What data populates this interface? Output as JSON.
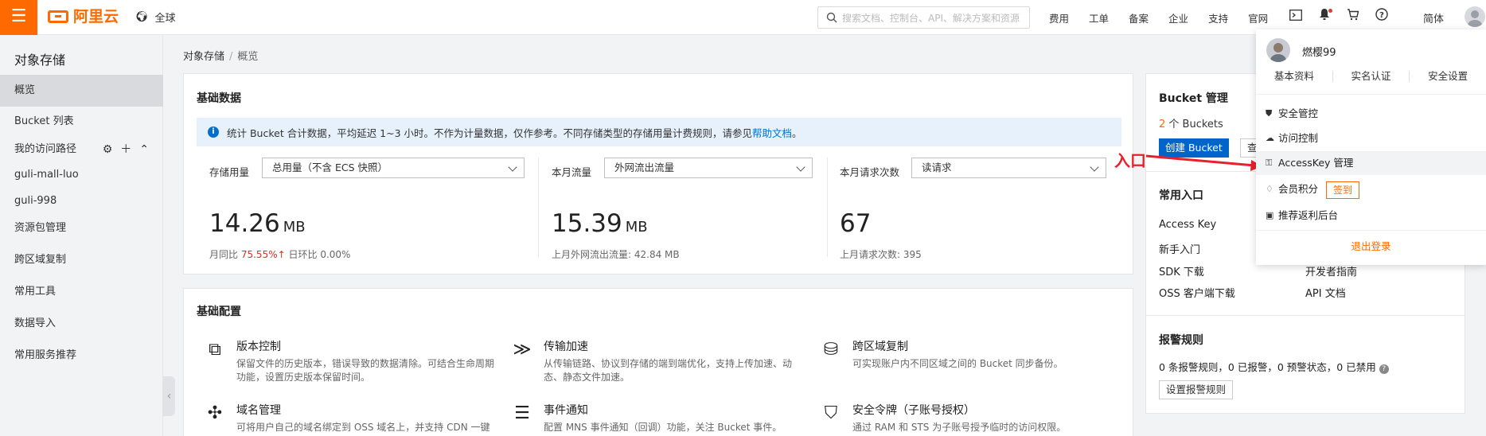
{
  "topbar": {
    "logo_text": "阿里云",
    "region_label": "全球",
    "search_placeholder": "搜索文档、控制台、API、解决方案和资源",
    "nav": [
      "费用",
      "工单",
      "备案",
      "企业",
      "支持",
      "官网"
    ],
    "language": "简体"
  },
  "sidebar": {
    "title": "对象存储",
    "items": [
      "概览",
      "Bucket 列表",
      "我的访问路径",
      "guli-mall-luo",
      "guli-998",
      "资源包管理",
      "跨区域复制",
      "常用工具",
      "数据导入",
      "常用服务推荐"
    ]
  },
  "breadcrumb": {
    "root": "对象存储",
    "sep": "/",
    "current": "概览"
  },
  "basic_data": {
    "title": "基础数据",
    "notice": "统计 Bucket 合计数据，平均延迟 1~3 小时。不作为计量数据，仅作参考。不同存储类型的存储用量计费规则，请参见",
    "notice_link": "帮助文档",
    "notice_end": "。",
    "metrics": [
      {
        "label": "存储用量",
        "select": "总用量（不含 ECS 快照）",
        "value": "14.26",
        "unit": "MB",
        "sub_a": "月同比",
        "sub_a_val": "75.55%↑",
        "sub_b": "日环比",
        "sub_b_val": "0.00%"
      },
      {
        "label": "本月流量",
        "select": "外网流出流量",
        "value": "15.39",
        "unit": "MB",
        "sub": "上月外网流出流量:  42.84 MB"
      },
      {
        "label": "本月请求次数",
        "select": "读请求",
        "value": "67",
        "sub": "上月请求次数:    395"
      }
    ]
  },
  "basic_config": {
    "title": "基础配置",
    "items": [
      {
        "icon": "version-control-icon",
        "title": "版本控制",
        "desc": "保留文件的历史版本，错误导致的数据清除。可结合生命周期功能，设置历史版本保留时间。"
      },
      {
        "icon": "transfer-accel-icon",
        "title": "传输加速",
        "desc": "从传输链路、协议到存储的端到端优化，支持上传加速、动态、静态文件加速。"
      },
      {
        "icon": "cross-region-icon",
        "title": "跨区域复制",
        "desc": "可实现账户内不同区域之间的 Bucket 同步备份。"
      },
      {
        "icon": "domain-icon",
        "title": "域名管理",
        "desc": "可将用户自己的域名绑定到 OSS 域名上，并支持 CDN 一键"
      },
      {
        "icon": "event-icon",
        "title": "事件通知",
        "desc": "配置 MNS 事件通知（回调）功能，关注 Bucket 事件。"
      },
      {
        "icon": "token-icon",
        "title": "安全令牌（子账号授权）",
        "desc": "通过 RAM 和 STS 为子账号授予临时的访问权限。"
      }
    ]
  },
  "bucket_mgmt": {
    "title": "Bucket 管理",
    "count": "2",
    "count_suffix": " 个 Buckets",
    "create_button": "创建 Bucket",
    "view_button": "查看",
    "common_title": "常用入口",
    "links": [
      "Access Key",
      "新手入门",
      "SDK 下载",
      "开发者指南",
      "OSS 客户端下载",
      "API 文档"
    ],
    "alarm_title": "报警规则",
    "alarm_text": "0 条报警规则，0 已报警，0 预警状态，0 已禁用",
    "alarm_button": "设置报警规则"
  },
  "user_popup": {
    "username": "燃樱99",
    "links": [
      "基本资料",
      "实名认证",
      "安全设置"
    ],
    "menu": [
      "安全管控",
      "访问控制",
      "AccessKey 管理",
      "会员积分",
      "推荐返利后台"
    ],
    "signin": "签到",
    "logout": "退出登录"
  },
  "annotation": {
    "label": "入口",
    "color": "#e8202a"
  },
  "colors": {
    "brand": "#ff6a00",
    "primary": "#0064c8",
    "link": "#0070cc",
    "alert": "#d93026"
  }
}
